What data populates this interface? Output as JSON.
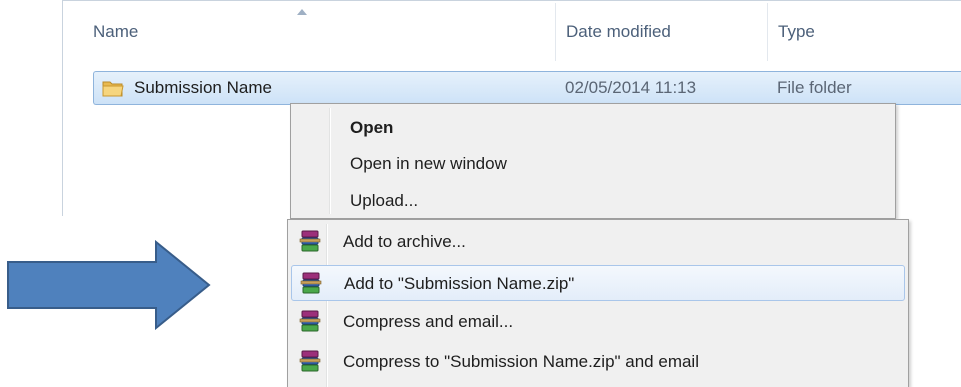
{
  "columns": {
    "name": "Name",
    "date_modified": "Date modified",
    "type": "Type"
  },
  "file": {
    "name": "Submission Name",
    "date": "02/05/2014 11:13",
    "type": "File folder",
    "icon": "folder-icon"
  },
  "context_menu": {
    "shell_items": [
      {
        "label": "Open",
        "bold": true
      },
      {
        "label": "Open in new window"
      },
      {
        "label": "Upload..."
      }
    ],
    "archive_items": [
      {
        "label": "Add to archive...",
        "icon": "winrar-icon"
      },
      {
        "label": "Add to \"Submission Name.zip\"",
        "icon": "winrar-icon",
        "highlighted": true
      },
      {
        "label": "Compress and email...",
        "icon": "winrar-icon"
      },
      {
        "label": "Compress to \"Submission Name.zip\" and email",
        "icon": "winrar-icon"
      }
    ]
  },
  "colors": {
    "arrow_fill": "#4f81bd",
    "arrow_stroke": "#385d8a",
    "selection": "#cde2f7"
  }
}
